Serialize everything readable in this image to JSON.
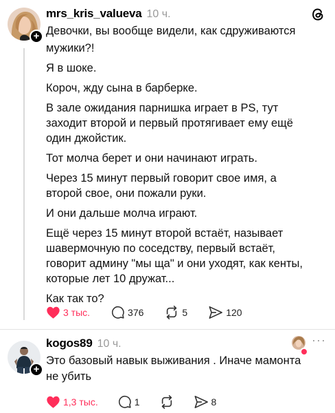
{
  "post1": {
    "username": "mrs_kris_valueva",
    "time": "10 ч.",
    "paragraphs": [
      "Девочки, вы вообще видели, как сдруживаются",
      "мужики?!",
      "Я в шоке.",
      "Короч, жду сына в барберке.",
      "В зале ожидания парнишка играет в PS, тут",
      "заходит второй и первый протягивает ему ещё",
      "один джойстик.",
      "Тот молча берет и они начинают играть.",
      "Через 15 минут первый говорит свое имя, а",
      "второй свое, они пожали руки.",
      "И они дальше молча играют.",
      "Ещё через 15 минут второй встаёт, называет",
      "шавермочную по соседству, первый встаёт,",
      "говорит админу \"мы ща\" и они уходят, как кенты,",
      "которые лет 10 дружат...",
      "Как так то?"
    ],
    "likes": "3 тыс.",
    "comments": "376",
    "reposts": "5",
    "shares": "120"
  },
  "post2": {
    "username": "kogos89",
    "time": "10 ч.",
    "lines": [
      "Это базовый навык выживания . Иначе мамонта",
      "не убить"
    ],
    "likes": "1,3 тыс.",
    "comments": "1",
    "shares": "8"
  },
  "colors": {
    "like": "#ff2e5a",
    "muted": "#9a9a9a",
    "line": "#d9d9d9"
  },
  "icons": [
    "threads-logo-icon",
    "heart-icon",
    "comment-icon",
    "repost-icon",
    "share-icon",
    "more-icon",
    "plus-icon"
  ]
}
